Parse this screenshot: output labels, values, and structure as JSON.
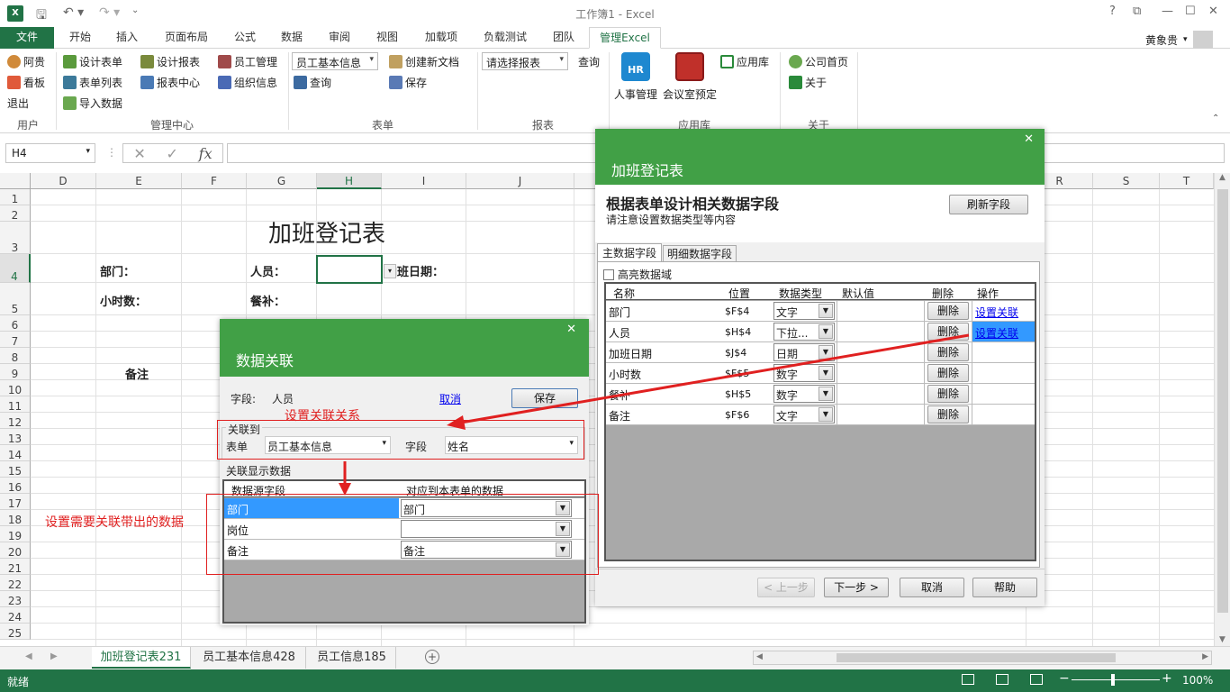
{
  "window": {
    "title": "工作簿1 - Excel",
    "help": "?",
    "user": "黄象贵"
  },
  "tabs": [
    "文件",
    "开始",
    "插入",
    "页面布局",
    "公式",
    "数据",
    "审阅",
    "视图",
    "加载项",
    "负载测试",
    "团队",
    "管理Excel"
  ],
  "ribbon": {
    "user_group": {
      "label": "用户",
      "items": [
        "阿贵",
        "看板",
        "退出"
      ]
    },
    "mgmt_group": {
      "label": "管理中心",
      "items": [
        "设计表单",
        "表单列表",
        "导入数据",
        "设计报表",
        "报表中心",
        "员工管理",
        "组织信息"
      ]
    },
    "form_group": {
      "label": "表单",
      "combo": "员工基本信息",
      "query": "查询",
      "new_doc": "创建新文档",
      "save": "保存"
    },
    "report_group": {
      "label": "报表",
      "combo": "请选择报表",
      "query": "查询"
    },
    "app_group": {
      "label": "应用库",
      "hr": "人事管理",
      "hr_badge": "HR",
      "meeting": "会议室预定",
      "library": "应用库"
    },
    "about_group": {
      "label": "关于",
      "home": "公司首页",
      "about": "关于"
    }
  },
  "formula": {
    "namebox": "H4",
    "fx": "fx"
  },
  "columns": [
    "D",
    "E",
    "F",
    "G",
    "H",
    "I",
    "J",
    "R",
    "S",
    "T"
  ],
  "rows": [
    "1",
    "2",
    "3",
    "4",
    "5",
    "6",
    "7",
    "8",
    "9",
    "10",
    "11",
    "12",
    "13",
    "14",
    "15",
    "16",
    "17",
    "18",
    "19",
    "20",
    "21",
    "22",
    "23",
    "24",
    "25"
  ],
  "sheet": {
    "title": "加班登记表",
    "dept": "部门：",
    "person": "人员：",
    "date": "加班日期：",
    "hours": "小时数：",
    "meal": "餐补：",
    "remark": "备注"
  },
  "dialog_main": {
    "title": "加班登记表",
    "heading": "根据表单设计相关数据字段",
    "subheading": "请注意设置数据类型等内容",
    "refresh": "刷新字段",
    "tabs": [
      "主数据字段",
      "明细数据字段"
    ],
    "highlight": "高亮数据域",
    "headers": [
      "名称",
      "位置",
      "数据类型",
      "默认值",
      "删除",
      "操作"
    ],
    "rows": [
      {
        "name": "部门",
        "pos": "$F$4",
        "type": "文字",
        "del": "删除",
        "op": "设置关联"
      },
      {
        "name": "人员",
        "pos": "$H$4",
        "type": "下拉...",
        "del": "删除",
        "op": "设置关联"
      },
      {
        "name": "加班日期",
        "pos": "$J$4",
        "type": "日期",
        "del": "删除",
        "op": ""
      },
      {
        "name": "小时数",
        "pos": "$F$5",
        "type": "数字",
        "del": "删除",
        "op": ""
      },
      {
        "name": "餐补",
        "pos": "$H$5",
        "type": "数字",
        "del": "删除",
        "op": ""
      },
      {
        "name": "备注",
        "pos": "$F$6",
        "type": "文字",
        "del": "删除",
        "op": ""
      }
    ],
    "prev": "< 上一步",
    "next": "下一步 >",
    "cancel": "取消",
    "help": "帮助"
  },
  "dialog_link": {
    "title": "数据关联",
    "field_label": "字段:",
    "field_value": "人员",
    "cancel": "取消",
    "save": "保存",
    "link_to": "关联到",
    "form_label": "表单",
    "form_value": "员工基本信息",
    "field2_label": "字段",
    "field2_value": "姓名",
    "display_group": "关联显示数据",
    "headers": [
      "数据源字段",
      "对应到本表单的数据"
    ],
    "rows": [
      {
        "src": "部门",
        "dst": "部门"
      },
      {
        "src": "岗位",
        "dst": ""
      },
      {
        "src": "备注",
        "dst": "备注"
      }
    ]
  },
  "annotations": {
    "a1": "设置关联关系",
    "a2": "设置需要关联带出的数据"
  },
  "sheet_tabs": [
    "加班登记表231",
    "员工基本信息428",
    "员工信息185"
  ],
  "status": {
    "ready": "就绪",
    "zoom": "100%"
  },
  "colors": {
    "excel_green": "#217346",
    "dialog_green": "#41a046",
    "annotation_red": "#e02020"
  }
}
